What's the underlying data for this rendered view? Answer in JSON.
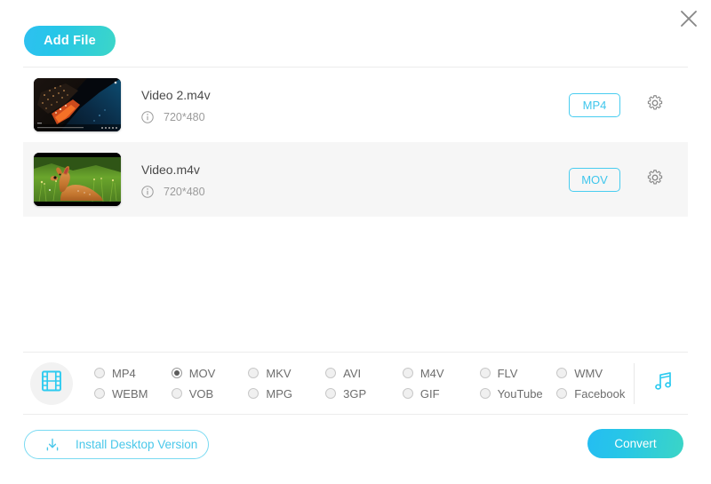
{
  "window": {
    "close_label": "×"
  },
  "toolbar": {
    "add_file_label": "Add File"
  },
  "files": [
    {
      "name": "Video 2.m4v",
      "resolution": "720*480",
      "output_format": "MP4",
      "thumbnail": "aerial-coastline-night",
      "selected": false
    },
    {
      "name": "Video.m4v",
      "resolution": "720*480",
      "output_format": "MOV",
      "thumbnail": "deer-in-meadow",
      "selected": true
    }
  ],
  "format_panel": {
    "media_type_icon": "film-strip-icon",
    "audio_icon": "music-note-icon",
    "options": [
      {
        "label": "MP4",
        "checked": false
      },
      {
        "label": "MOV",
        "checked": true
      },
      {
        "label": "MKV",
        "checked": false
      },
      {
        "label": "AVI",
        "checked": false
      },
      {
        "label": "M4V",
        "checked": false
      },
      {
        "label": "FLV",
        "checked": false
      },
      {
        "label": "WMV",
        "checked": false
      },
      {
        "label": "WEBM",
        "checked": false
      },
      {
        "label": "VOB",
        "checked": false
      },
      {
        "label": "MPG",
        "checked": false
      },
      {
        "label": "3GP",
        "checked": false
      },
      {
        "label": "GIF",
        "checked": false
      },
      {
        "label": "YouTube",
        "checked": false
      },
      {
        "label": "Facebook",
        "checked": false
      }
    ]
  },
  "footer": {
    "install_label": "Install Desktop Version",
    "install_icon": "download-icon",
    "convert_label": "Convert"
  },
  "colors": {
    "accent_cyan": "#3fc6ec",
    "accent_teal": "#3bd5c6",
    "text_primary": "#4a4a4a",
    "text_muted": "#9b9b9b",
    "row_alt_bg": "#f6f6f6"
  }
}
